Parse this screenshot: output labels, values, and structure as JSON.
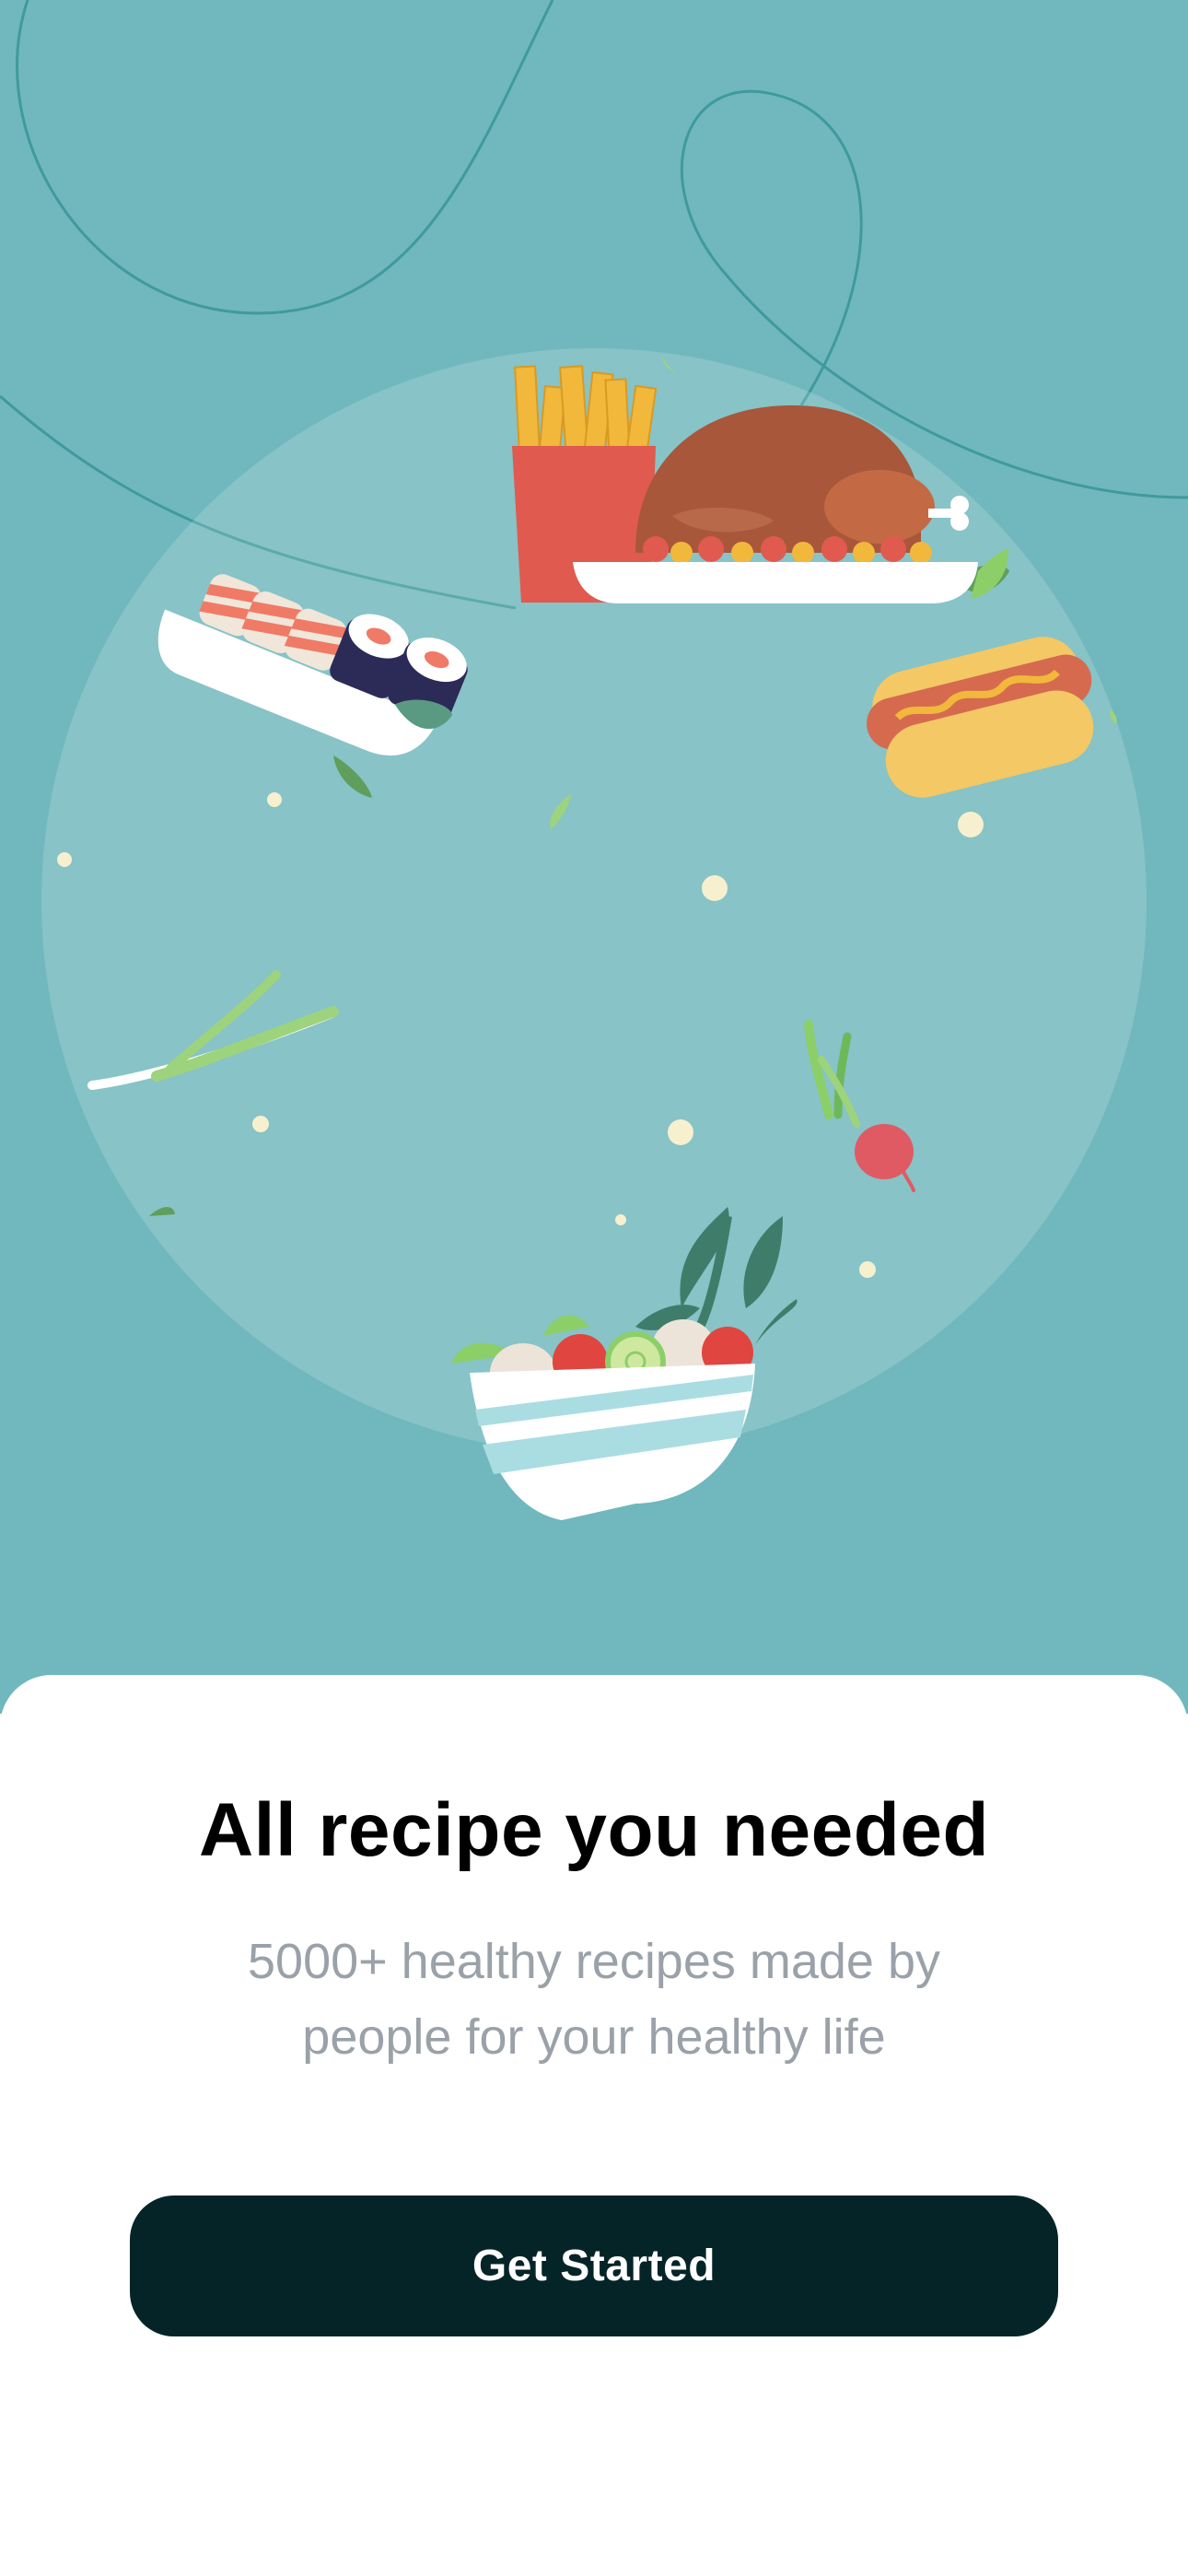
{
  "onboarding": {
    "title": "All recipe you needed",
    "subtitle": "5000+ healthy recipes made by people for your healthy life",
    "cta_label": "Get Started"
  },
  "illustration": {
    "items": [
      "fries-icon",
      "roast-chicken-icon",
      "sushi-icon",
      "hotdog-icon",
      "spring-onion-icon",
      "radish-icon",
      "salad-bowl-icon"
    ]
  },
  "colors": {
    "hero_background": "#70b8bd",
    "button_background": "#052427",
    "title": "#000000",
    "subtitle": "#9aa1a8"
  }
}
